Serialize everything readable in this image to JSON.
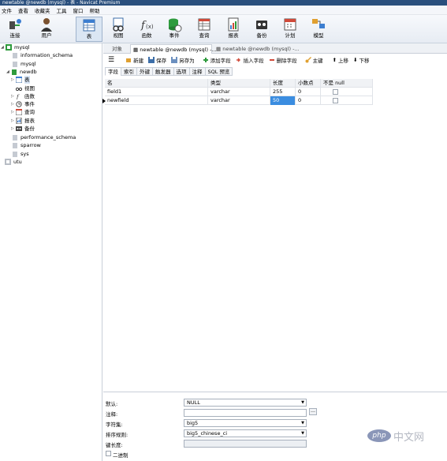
{
  "window": {
    "title": "newtable @newdb (mysql) - 表 - Navicat Premium"
  },
  "menu": [
    "文件",
    "查看",
    "收藏夹",
    "工具",
    "窗口",
    "帮助"
  ],
  "toolbar": {
    "connect": "连接",
    "user": "用户",
    "table": "表",
    "view": "视图",
    "function": "函数",
    "event": "事件",
    "query": "查询",
    "report": "报表",
    "backup": "备份",
    "schedule": "计划",
    "model": "模型"
  },
  "sidebar": {
    "conn1": "mysql",
    "db_info_schema": "information_schema",
    "db_mysql": "mysql",
    "db_newdb": "newdb",
    "node_tables": "表",
    "node_views": "视图",
    "node_functions": "函数",
    "node_events": "事件",
    "node_queries": "查询",
    "node_reports": "报表",
    "node_backups": "备份",
    "db_perf": "performance_schema",
    "db_sparrow": "sparrow",
    "db_sys": "sys",
    "conn2": "utu"
  },
  "tabs": {
    "objects": "对象",
    "tab1": "newtable @newdb (mysql) -...",
    "tab2": "newtable @newdb (mysql) -..."
  },
  "ctoolbar": {
    "new": "新建",
    "save": "保存",
    "save_as": "另存为",
    "add_field": "添加字段",
    "insert_field": "插入字段",
    "delete_field": "删除字段",
    "primary_key": "主键",
    "move_up": "上移",
    "move_down": "下移"
  },
  "subtabs": [
    "字段",
    "索引",
    "外键",
    "触发器",
    "选项",
    "注释",
    "SQL 预览"
  ],
  "grid": {
    "headers": {
      "name": "名",
      "type": "类型",
      "length": "长度",
      "decimals": "小数点",
      "not_null": "不是 null"
    },
    "rows": [
      {
        "name": "field1",
        "type": "varchar",
        "length": "255",
        "decimals": "0"
      },
      {
        "name": "newfield",
        "type": "varchar",
        "length": "50",
        "decimals": "0"
      }
    ]
  },
  "props": {
    "default_label": "默认:",
    "default_value": "NULL",
    "comment_label": "注释:",
    "comment_value": "",
    "charset_label": "字符集:",
    "charset_value": "big5",
    "collation_label": "排序规则:",
    "collation_value": "big5_chinese_ci",
    "keylen_label": "键长度:",
    "keylen_value": "",
    "binary_label": "二进制"
  },
  "watermark": {
    "logo": "php",
    "text": "中文网"
  },
  "colors": {
    "titlebar": "#2a4f7d",
    "selection": "#3b8de0",
    "accent_green": "#2e9b3d"
  }
}
